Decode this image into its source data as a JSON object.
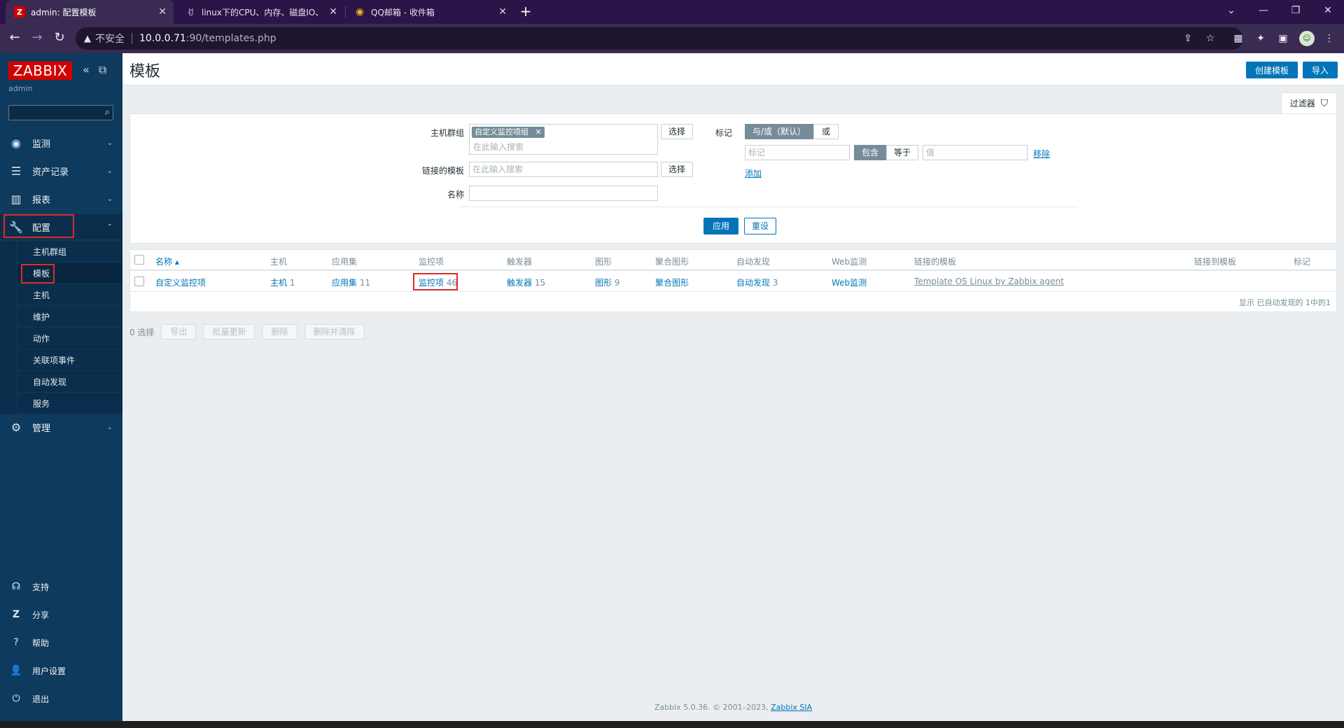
{
  "browser": {
    "tabs": [
      {
        "favicon": "Z",
        "title": "admin: 配置模板"
      },
      {
        "favicon": "ꀀ",
        "title": "linux下的CPU、内存、磁盘IO、"
      },
      {
        "favicon": "◉",
        "title": "QQ邮箱 - 收件箱"
      }
    ],
    "address": {
      "insecure_label": "不安全",
      "host": "10.0.0.71",
      "path": ":90/templates.php"
    }
  },
  "sidebar": {
    "logo": "ZABBIX",
    "user": "admin",
    "menu": [
      {
        "label": "监测",
        "icon": "eye-icon"
      },
      {
        "label": "资产记录",
        "icon": "list-icon"
      },
      {
        "label": "报表",
        "icon": "bar-chart-icon"
      },
      {
        "label": "配置",
        "icon": "wrench-icon"
      },
      {
        "label": "管理",
        "icon": "gear-icon"
      }
    ],
    "config_submenu": [
      "主机群组",
      "模板",
      "主机",
      "维护",
      "动作",
      "关联项事件",
      "自动发现",
      "服务"
    ],
    "bottom": [
      {
        "label": "支持",
        "icon": "headset-icon"
      },
      {
        "label": "分享",
        "icon": "share-icon"
      },
      {
        "label": "帮助",
        "icon": "help-icon"
      },
      {
        "label": "用户设置",
        "icon": "user-icon"
      },
      {
        "label": "退出",
        "icon": "power-icon"
      }
    ]
  },
  "header": {
    "title": "模板",
    "create_button": "创建模板",
    "import_button": "导入"
  },
  "filter": {
    "tab_label": "过滤器",
    "host_group_label": "主机群组",
    "host_group_chip": "自定义监控项组",
    "search_placeholder": "在此输入搜索",
    "select_button": "选择",
    "linked_templates_label": "链接的模板",
    "name_label": "名称",
    "name_value": "",
    "tags_label": "标记",
    "and_or": "与/或（默认）",
    "or": "或",
    "tag_placeholder": "标记",
    "contains": "包含",
    "equals": "等于",
    "value_placeholder": "值",
    "remove": "移除",
    "add": "添加",
    "apply": "应用",
    "reset": "重设"
  },
  "table": {
    "headers": {
      "name": "名称 ▴",
      "hosts": "主机",
      "applications": "应用集",
      "items": "监控项",
      "triggers": "触发器",
      "graphs": "图形",
      "screens": "聚合图形",
      "discovery": "自动发现",
      "web": "Web监测",
      "linked_templates": "链接的模板",
      "linked_to": "链接到模板",
      "tags": "标记"
    },
    "row": {
      "name": "自定义监控项",
      "hosts_label": "主机",
      "hosts_count": "1",
      "applications_label": "应用集",
      "applications_count": "11",
      "items_label": "监控项",
      "items_count": "46",
      "triggers_label": "触发器",
      "triggers_count": "15",
      "graphs_label": "图形",
      "graphs_count": "9",
      "screens_label": "聚合图形",
      "discovery_label": "自动发现",
      "discovery_count": "3",
      "web_label": "Web监测",
      "linked_template": "Template OS Linux by Zabbix agent"
    },
    "paging": "显示 已自动发现的 1中的1"
  },
  "actions": {
    "selected": "0 选择",
    "export": "导出",
    "mass_update": "批量更新",
    "delete": "删除",
    "delete_clear": "删除并清除"
  },
  "footer": {
    "text": "Zabbix 5.0.36. © 2001–2023, ",
    "link": "Zabbix SIA"
  }
}
